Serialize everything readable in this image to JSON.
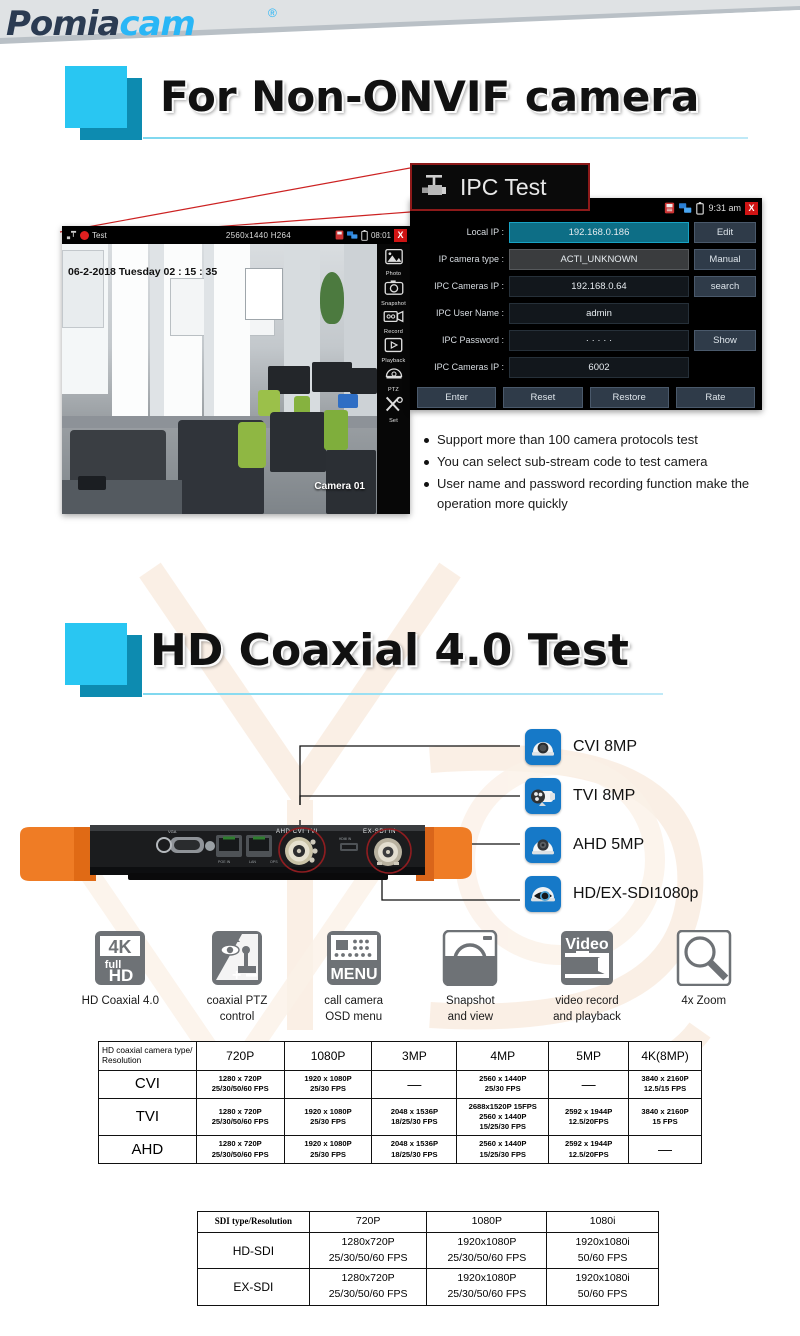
{
  "brand": {
    "name_dark": "Pomia",
    "name_light": "cam",
    "registered": "®"
  },
  "sections": [
    {
      "title": "For Non-ONVIF camera"
    },
    {
      "title": "HD Coaxial 4.0 Test"
    }
  ],
  "camera_screen": {
    "status_left": "Test",
    "status_mid": "2560x1440 H264",
    "status_time": "08:01",
    "close_label": "X",
    "timestamp": "06-2-2018 Tuesday 02 : 15 : 35",
    "camera_label": "Camera 01",
    "sidebar": [
      {
        "label": "Photo",
        "icon": "photo-icon"
      },
      {
        "label": "Snapshot",
        "icon": "snapshot-icon"
      },
      {
        "label": "Record",
        "icon": "record-icon"
      },
      {
        "label": "Playback",
        "icon": "playback-icon"
      },
      {
        "label": "PTZ",
        "icon": "ptz-icon"
      },
      {
        "label": "Set",
        "icon": "settings-icon"
      }
    ]
  },
  "ipc_badge": {
    "title": "IPC Test",
    "icon": "camera-icon"
  },
  "ipc_panel": {
    "status_time": "9:31 am",
    "close_label": "X",
    "icons": [
      "sdcard-icon",
      "network-icon",
      "battery-icon"
    ],
    "rows": [
      {
        "label": "Local IP :",
        "value": "192.168.0.186",
        "button": "Edit",
        "style": "hl"
      },
      {
        "label": "IP camera type :",
        "value": "ACTI_UNKNOWN",
        "button": "Manual",
        "style": "gray"
      },
      {
        "label": "IPC Cameras IP :",
        "value": "192.168.0.64",
        "button": "search",
        "style": ""
      },
      {
        "label": "IPC User Name :",
        "value": "admin",
        "button": "",
        "style": ""
      },
      {
        "label": "IPC Password :",
        "value": "· · · · ·",
        "button": "Show",
        "style": ""
      },
      {
        "label": "IPC Cameras IP :",
        "value": "6002",
        "button": "",
        "style": ""
      }
    ],
    "footer_buttons": [
      "Enter",
      "Reset",
      "Restore",
      "Rate"
    ]
  },
  "bullets": [
    "Support more than 100 camera protocols test",
    "You can select sub-stream code to test camera",
    "User name and password recording function make the operation more quickly"
  ],
  "device": {
    "port_labels": [
      "AHD CVI TVI",
      "EX-SDI IN",
      "VGA",
      "POE IN",
      "LAN",
      "OPS",
      "HDMI IN"
    ]
  },
  "callouts": [
    {
      "label": "CVI 8MP",
      "icon": "dome-camera-icon"
    },
    {
      "label": "TVI 8MP",
      "icon": "bullet-camera-icon"
    },
    {
      "label": "AHD 5MP",
      "icon": "dome-camera-icon"
    },
    {
      "label": "HD/EX-SDI1080p",
      "icon": "eye-camera-icon"
    }
  ],
  "features": [
    {
      "icon": "4k-full-hd-icon",
      "caption": "HD Coaxial 4.0",
      "badge_top": "4K",
      "badge_mid": "full",
      "badge_bot": "HD"
    },
    {
      "icon": "ptz-control-icon",
      "caption": "coaxial PTZ\ncontrol"
    },
    {
      "icon": "osd-menu-icon",
      "caption": "call camera\nOSD menu",
      "badge": "MENU"
    },
    {
      "icon": "snapshot-icon",
      "caption": "Snapshot\nand view"
    },
    {
      "icon": "video-record-icon",
      "caption": "video record\nand playback",
      "badge": "Video"
    },
    {
      "icon": "zoom-icon",
      "caption": "4x Zoom"
    }
  ],
  "table_coaxial": {
    "headers": [
      "HD coaxial camera type/ Resolution",
      "720P",
      "1080P",
      "3MP",
      "4MP",
      "5MP",
      "4K(8MP)"
    ],
    "rows": [
      {
        "name": "CVI",
        "cells": [
          {
            "l1": "1280 x 720P",
            "l2": "25/30/50/60 FPS"
          },
          {
            "l1": "1920 x 1080P",
            "l2": "25/30 FPS"
          },
          {
            "l1": "—",
            "l2": ""
          },
          {
            "l1": "2560 x 1440P",
            "l2": "25/30 FPS"
          },
          {
            "l1": "—",
            "l2": ""
          },
          {
            "l1": "3840 x 2160P",
            "l2": "12.5/15 FPS"
          }
        ]
      },
      {
        "name": "TVI",
        "cells": [
          {
            "l1": "1280 x 720P",
            "l2": "25/30/50/60 FPS"
          },
          {
            "l1": "1920 x 1080P",
            "l2": "25/30 FPS"
          },
          {
            "l1": "2048 x 1536P",
            "l2": "18/25/30 FPS"
          },
          {
            "l1": "2688x1520P 15FPS",
            "l2": "2560 x 1440P",
            "l3": "15/25/30 FPS"
          },
          {
            "l1": "2592 x 1944P",
            "l2": "12.5/20FPS"
          },
          {
            "l1": "3840 x 2160P",
            "l2": "15 FPS"
          }
        ]
      },
      {
        "name": "AHD",
        "cells": [
          {
            "l1": "1280 x 720P",
            "l2": "25/30/50/60 FPS"
          },
          {
            "l1": "1920 x 1080P",
            "l2": "25/30 FPS"
          },
          {
            "l1": "2048 x 1536P",
            "l2": "18/25/30 FPS"
          },
          {
            "l1": "2560 x 1440P",
            "l2": "15/25/30 FPS"
          },
          {
            "l1": "2592 x 1944P",
            "l2": "12.5/20FPS"
          },
          {
            "l1": "—",
            "l2": ""
          }
        ]
      }
    ]
  },
  "table_sdi": {
    "headers": [
      "SDI type/Resolution",
      "720P",
      "1080P",
      "1080i"
    ],
    "rows": [
      {
        "name": "HD-SDI",
        "cells": [
          {
            "l1": "1280x720P",
            "l2": "25/30/50/60 FPS"
          },
          {
            "l1": "1920x1080P",
            "l2": "25/30/50/60 FPS"
          },
          {
            "l1": "1920x1080i",
            "l2": "50/60 FPS"
          }
        ]
      },
      {
        "name": "EX-SDI",
        "cells": [
          {
            "l1": "1280x720P",
            "l2": "25/30/50/60 FPS"
          },
          {
            "l1": "1920x1080P",
            "l2": "25/30/50/60 FPS"
          },
          {
            "l1": "1920x1080i",
            "l2": "50/60 FPS"
          }
        ]
      }
    ]
  },
  "colors": {
    "accent_cyan": "#29c6f2",
    "accent_cyan_dark": "#0d8bb0",
    "icon_blue": "#1679c8",
    "badge_red": "#8d1a1a",
    "close_red": "#d01414"
  }
}
